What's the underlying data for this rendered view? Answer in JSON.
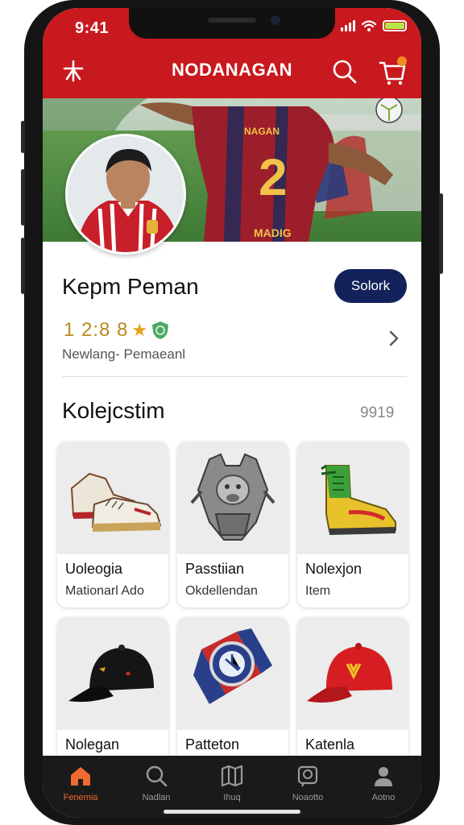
{
  "status_bar": {
    "time": "9:41"
  },
  "header": {
    "title": "NODANAGAN"
  },
  "profile": {
    "name": "Kepm Peman",
    "follow_label": "Solork",
    "stats": "1 2:8 8",
    "subtitle": "Newlang- Pemaeanl"
  },
  "collection": {
    "title": "Kolejcstim",
    "count": "9919",
    "items": [
      {
        "title": "Uoleogia",
        "subtitle": "Mationarl Ado",
        "icon": "sneakers-icon"
      },
      {
        "title": "Passtiian",
        "subtitle": "Okdellendan",
        "icon": "trophy-icon"
      },
      {
        "title": "Nolexjon",
        "subtitle": "Item",
        "icon": "boot-icon"
      },
      {
        "title": "Nolegan",
        "subtitle": "",
        "icon": "cap-icon"
      },
      {
        "title": "Patteton",
        "subtitle": "",
        "icon": "watch-icon"
      },
      {
        "title": "Katenla",
        "subtitle": "",
        "icon": "red-cap-icon"
      }
    ]
  },
  "tabbar": {
    "items": [
      {
        "label": "Fenemia",
        "icon": "home-icon",
        "active": true
      },
      {
        "label": "Nadlan",
        "icon": "search-icon",
        "active": false
      },
      {
        "label": "Ihuq",
        "icon": "map-icon",
        "active": false
      },
      {
        "label": "Noaotto",
        "icon": "clock-icon",
        "active": false
      },
      {
        "label": "Aotno",
        "icon": "profile-icon",
        "active": false
      }
    ]
  },
  "colors": {
    "brand_red": "#c8191e",
    "button_navy": "#13225a",
    "active_tab": "#ee6a2e",
    "tabbar_bg": "#1a1a1a"
  }
}
